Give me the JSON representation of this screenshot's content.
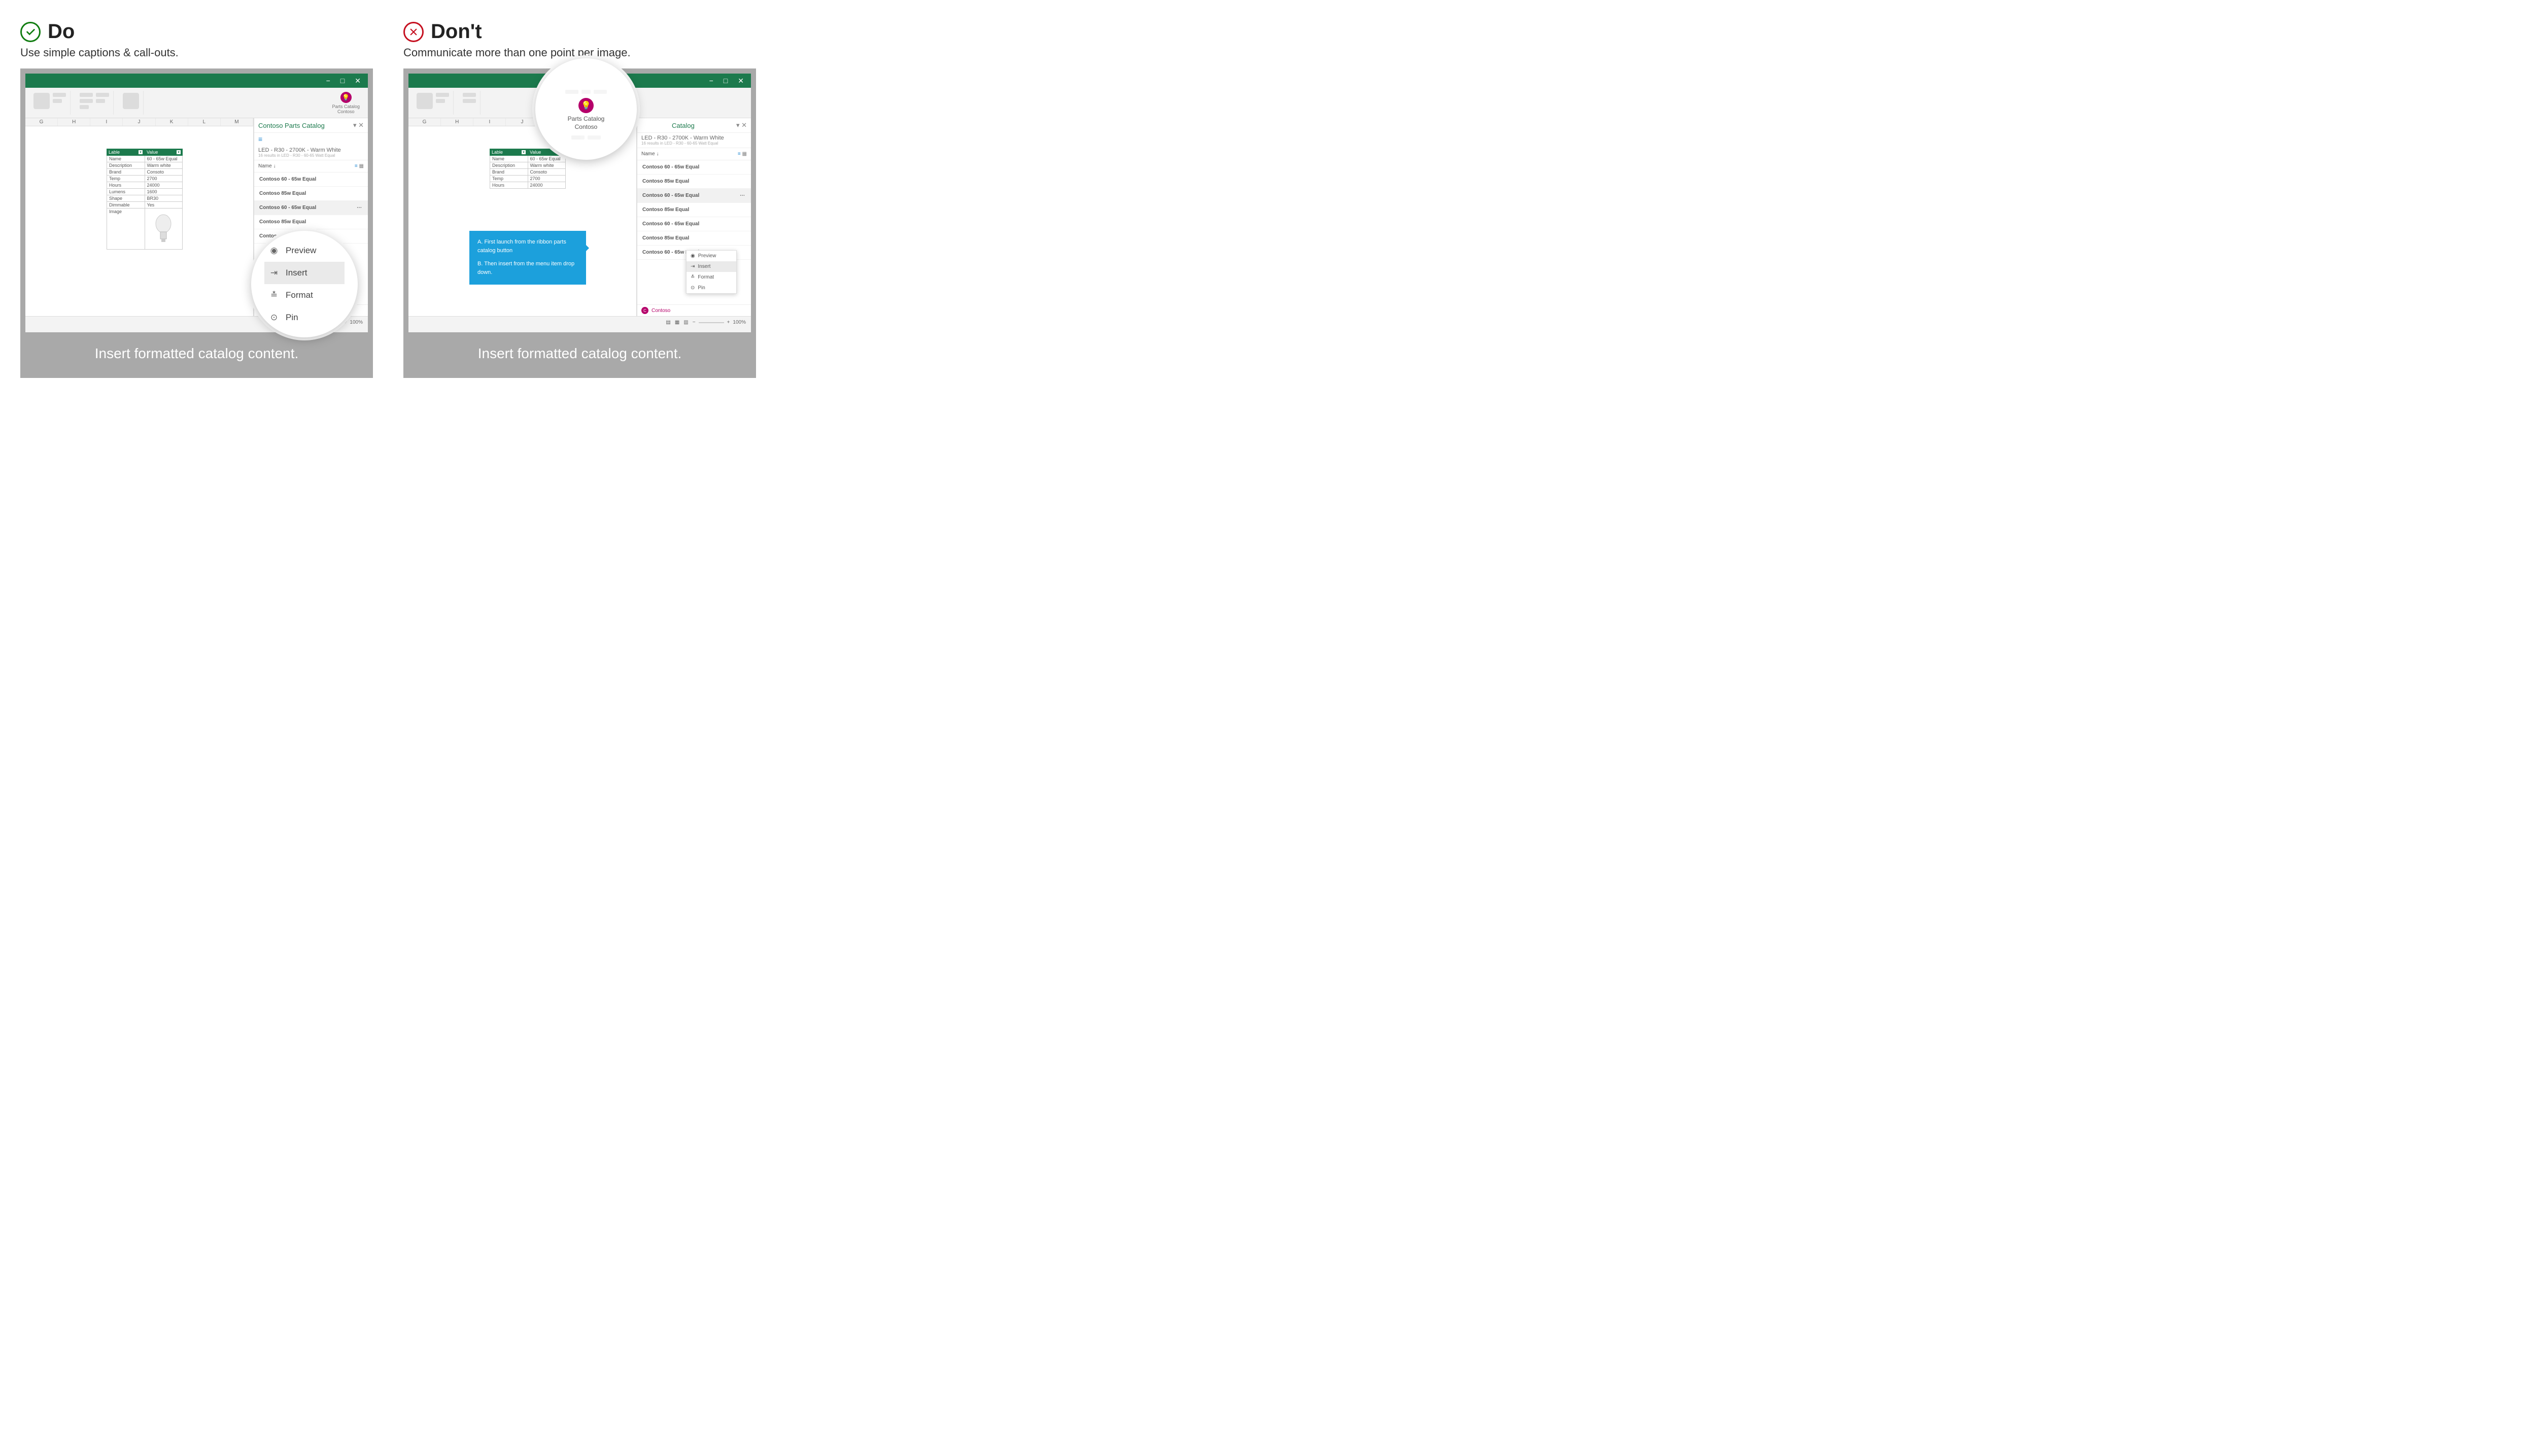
{
  "left": {
    "heading": "Do",
    "subtitle": "Use simple captions & call-outs.",
    "caption": "Insert formatted catalog content."
  },
  "right": {
    "heading": "Don't",
    "subtitle": "Communicate more than one point per image.",
    "caption": "Insert formatted catalog content."
  },
  "excel": {
    "addin_name": "Parts Catalog",
    "addin_vendor": "Contoso",
    "pane_title": "Contoso Parts Catalog",
    "breadcrumb": "LED - R30 - 2700K - Warm White",
    "breadcrumb_sub": "16 results in LED - R30 - 60-65 Watt Equal",
    "list_name_col": "Name",
    "footer_user": "Contoso",
    "zoom": "100%",
    "columns": [
      "G",
      "H",
      "I",
      "J",
      "K",
      "L",
      "M"
    ],
    "table": {
      "headers": [
        "Lable",
        "Value"
      ],
      "rows": [
        [
          "Name",
          "60 - 65w Equal"
        ],
        [
          "Description",
          "Warm white"
        ],
        [
          "Brand",
          "Consoto"
        ],
        [
          "Temp",
          "2700"
        ],
        [
          "Hours",
          "24000"
        ],
        [
          "Lumens",
          "1600"
        ],
        [
          "Shape",
          "BR30"
        ],
        [
          "Dimmable",
          "Yes"
        ],
        [
          "Image",
          ""
        ]
      ]
    },
    "products": [
      "Contoso 60 - 65w Equal",
      "Contoso 85w Equal",
      "Contoso 60 - 65w Equal",
      "Contoso 85w Equal",
      "Contoso 60 - 65w Equal",
      "Contoso 85w Equal",
      "Contoso 60 - 65w Equal"
    ]
  },
  "menu": {
    "preview": "Preview",
    "insert": "Insert",
    "format": "Format",
    "pin": "Pin"
  },
  "magnifier_addin": {
    "title": "Parts Catalog",
    "vendor": "Contoso"
  },
  "callout": {
    "a": "A.  First launch from the ribbon parts catalog button",
    "b": "B.  Then insert from the menu item drop down."
  }
}
